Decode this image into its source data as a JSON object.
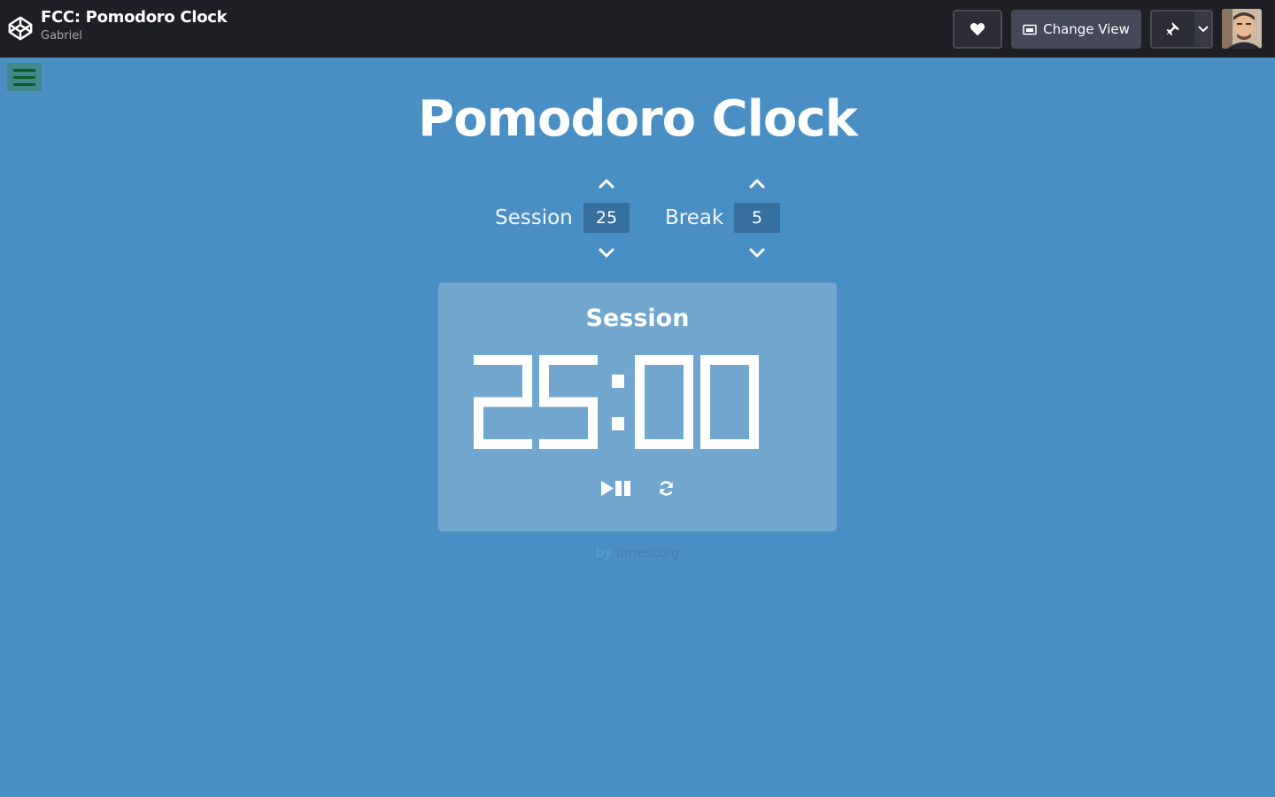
{
  "header": {
    "pen_title": "FCC: Pomodoro Clock",
    "author": "Gabriel",
    "heart_icon": "heart-icon",
    "change_view_label": "Change View",
    "pin_icon": "pin-icon"
  },
  "app": {
    "title": "Pomodoro Clock",
    "session_label": "Session",
    "session_length": "25",
    "break_label": "Break",
    "break_length": "5",
    "timer_label": "Session",
    "time_display": "25:00",
    "credit_by": "by",
    "credit_author": "ionescuig"
  },
  "colors": {
    "background": "#4a8fc4",
    "panel": "#71a6cf",
    "topbar": "#1f1f26",
    "value_box": "#35709f"
  }
}
